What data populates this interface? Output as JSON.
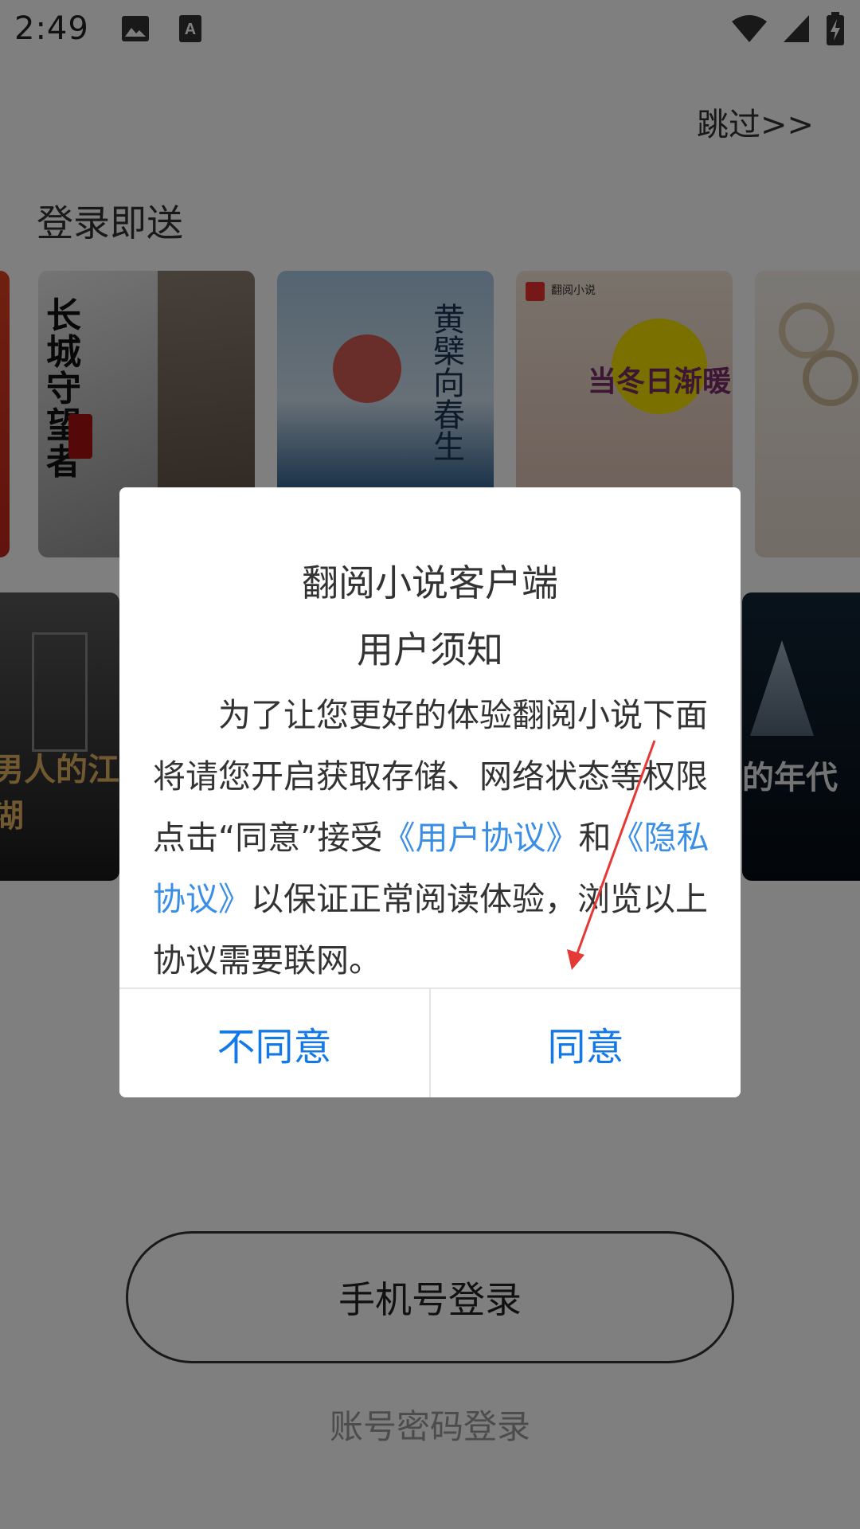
{
  "status_bar": {
    "time": "2:49",
    "notif_icons": [
      "image-icon",
      "text-a-icon"
    ],
    "right_icons": [
      "wifi-icon",
      "signal-icon",
      "battery-icon"
    ]
  },
  "header": {
    "skip_label": "跳过>>"
  },
  "promo": {
    "title": "登录即送",
    "books_row1": [
      {
        "title": "长城守望者",
        "colors": [
          "#cfcfcf",
          "#6b6b6b"
        ],
        "accent": "#a11"
      },
      {
        "title": "黄檗向春生",
        "colors": [
          "#9cc0dc",
          "#21446a"
        ],
        "accent": "#c73"
      },
      {
        "title": "当冬日渐暖",
        "colors": [
          "#efe0cf",
          "#d6b0a0"
        ],
        "accent": "#f2e100"
      },
      {
        "title": "",
        "colors": [
          "#f3ede6",
          "#e2d6cb"
        ],
        "accent": "#bba"
      }
    ],
    "books_row2": [
      {
        "title": "男人的江湖",
        "colors": [
          "#3a3a3a",
          "#111"
        ],
        "accent": "#e0b060"
      },
      {
        "title": "的年代",
        "colors": [
          "#0d1f2f",
          "#06101a"
        ],
        "accent": "#9ab"
      }
    ]
  },
  "login": {
    "phone_label": "手机号登录",
    "account_label": "账号密码登录"
  },
  "dialog": {
    "title1": "翻阅小说客户端",
    "title2": "用户须知",
    "body_part1": "为了让您更好的体验翻阅小说下面将请您开启获取存储、网络状态等权限点击“同意”接受",
    "user_agreement": "《用户协议》",
    "body_and": "和",
    "privacy_agreement": "《隐私协议》",
    "body_part2": "以保证正常阅读体验，浏览以上协议需要联网。",
    "disagree_label": "不同意",
    "agree_label": "同意"
  },
  "colors": {
    "link": "#3a8ee6",
    "button": "#1479e8",
    "annotation_arrow": "#e53935"
  }
}
